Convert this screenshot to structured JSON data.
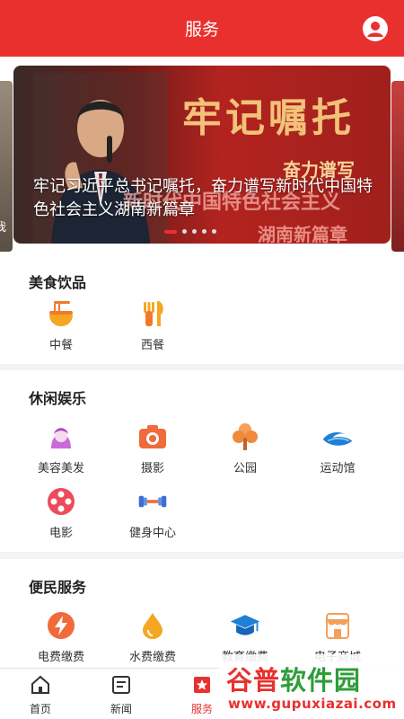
{
  "header": {
    "title": "服务"
  },
  "banner": {
    "caption": "牢记习近平总书记嘱托，奋力谱写新时代中国特色社会主义湖南新篇章",
    "big_text": "牢记嘱托",
    "sub1": "奋力谱写",
    "sub2": "新时代中国特色社会主义",
    "sub3": "湖南新篇章",
    "left_peek_text": "我"
  },
  "sections": {
    "food": {
      "title": "美食饮品",
      "items": [
        {
          "label": "中餐",
          "icon": "noodle-bowl-icon"
        },
        {
          "label": "西餐",
          "icon": "fork-knife-icon"
        }
      ]
    },
    "leisure": {
      "title": "休闲娱乐",
      "items": [
        {
          "label": "美容美发",
          "icon": "beauty-icon"
        },
        {
          "label": "摄影",
          "icon": "camera-icon"
        },
        {
          "label": "公园",
          "icon": "tree-icon"
        },
        {
          "label": "运动馆",
          "icon": "wave-icon"
        },
        {
          "label": "电影",
          "icon": "film-reel-icon"
        },
        {
          "label": "健身中心",
          "icon": "dumbbell-icon"
        }
      ]
    },
    "civic": {
      "title": "便民服务",
      "items": [
        {
          "label": "电费缴费",
          "icon": "lightning-icon"
        },
        {
          "label": "水费缴费",
          "icon": "water-drop-icon"
        },
        {
          "label": "教育缴费",
          "icon": "graduation-cap-icon"
        },
        {
          "label": "电子商城",
          "icon": "store-icon"
        }
      ]
    }
  },
  "tabbar": {
    "items": [
      {
        "label": "首页",
        "icon": "home-icon"
      },
      {
        "label": "新闻",
        "icon": "news-icon"
      },
      {
        "label": "服务",
        "icon": "service-icon",
        "active": true
      }
    ]
  },
  "watermark": {
    "brand_a": "谷普",
    "brand_b": "软件园",
    "url": "www.gupuxiazai.com"
  },
  "colors": {
    "accent": "#e8312f",
    "orange": "#f07a2a",
    "blue": "#1e7fd6"
  }
}
